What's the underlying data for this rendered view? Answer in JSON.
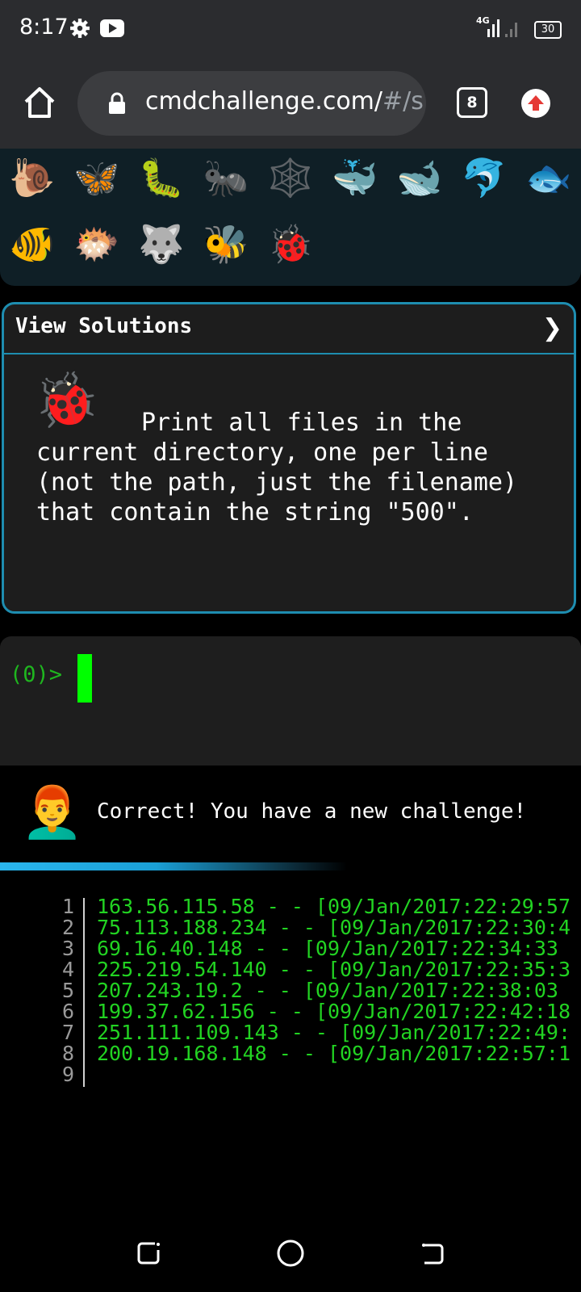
{
  "status_bar": {
    "time": "8:17",
    "network": "4G",
    "battery": "30",
    "icons": [
      "gear-icon",
      "youtube-icon",
      "signal-icon",
      "battery-icon"
    ]
  },
  "browser": {
    "url_main": "cmdchallenge.com/",
    "url_rest": "#/s",
    "tab_count": "8",
    "icons": [
      "home-icon",
      "lock-icon",
      "tabs-icon",
      "update-icon"
    ]
  },
  "emojis": [
    "🐌",
    "🦋",
    "🐛",
    "🐜",
    "🕸️",
    "🐳",
    "🐋",
    "🐬",
    "🐟",
    "🐠",
    "🐡",
    "🐺",
    "🐝",
    "🐞"
  ],
  "card": {
    "title": "View Solutions",
    "chevron": "❯",
    "challenge_icon": "🐞",
    "challenge_text": "Print all files in the current directory, one per line (not the path, just the filename) that contain the string \"500\"."
  },
  "terminal": {
    "prompt": "(0)>"
  },
  "result": {
    "avatar": "👨‍🦰",
    "message": "Correct! You have a new challenge!"
  },
  "output": {
    "lines": [
      {
        "num": "1",
        "text": "163.56.115.58 - - [09/Jan/2017:22:29:57"
      },
      {
        "num": "2",
        "text": "75.113.188.234 - - [09/Jan/2017:22:30:4"
      },
      {
        "num": "3",
        "text": "69.16.40.148 - - [09/Jan/2017:22:34:33"
      },
      {
        "num": "4",
        "text": "225.219.54.140 - - [09/Jan/2017:22:35:3"
      },
      {
        "num": "5",
        "text": "207.243.19.2 - - [09/Jan/2017:22:38:03"
      },
      {
        "num": "6",
        "text": "199.37.62.156 - - [09/Jan/2017:22:42:18"
      },
      {
        "num": "7",
        "text": "251.111.109.143 - - [09/Jan/2017:22:49:"
      },
      {
        "num": "8",
        "text": "200.19.168.148 - - [09/Jan/2017:22:57:1"
      },
      {
        "num": "9",
        "text": ""
      }
    ]
  },
  "colors": {
    "accent": "#1e8db0",
    "terminal_green": "#22d322",
    "cursor": "#00ff00",
    "progress": "#2ab6ee"
  }
}
